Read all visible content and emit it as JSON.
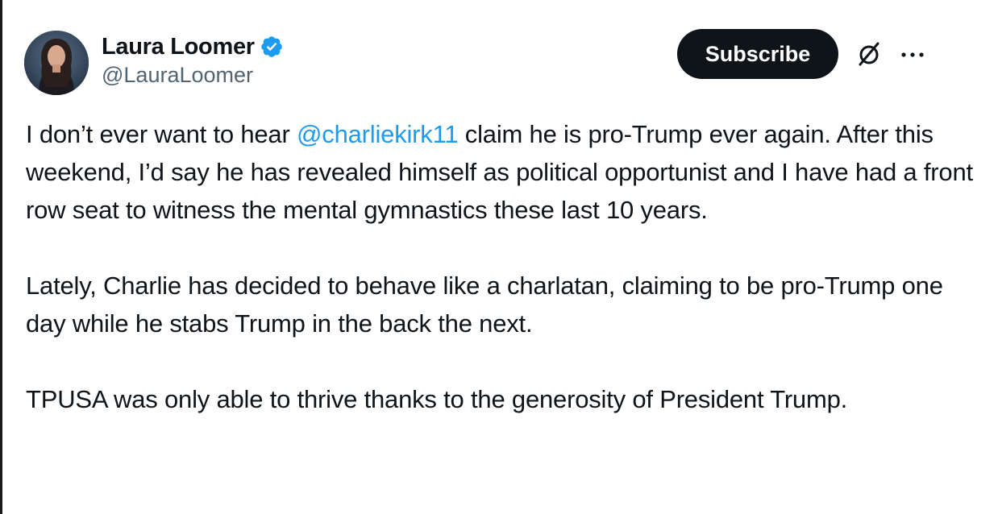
{
  "author": {
    "display_name": "Laura Loomer",
    "handle": "@LauraLoomer",
    "verified": true
  },
  "actions": {
    "subscribe_label": "Subscribe",
    "grok_icon": "grok-icon",
    "more_icon": "more-icon"
  },
  "tweet": {
    "p1_before": "I don’t ever want to hear ",
    "p1_mention": "@charliekirk11",
    "p1_after": " claim he is pro-Trump ever again. After this weekend, I’d say he has revealed himself as political opportunist and I have had a front row seat to witness the mental gymnastics these last 10 years.",
    "p2": "Lately, Charlie has decided to behave like a charlatan, claiming to be pro-Trump one day while he stabs Trump in the back the next.",
    "p3": "TPUSA was only able to thrive thanks to the generosity of President Trump."
  },
  "colors": {
    "accent": "#1d9bf0",
    "text_primary": "#0f1419",
    "text_secondary": "#536471",
    "button_bg": "#0f1419"
  }
}
